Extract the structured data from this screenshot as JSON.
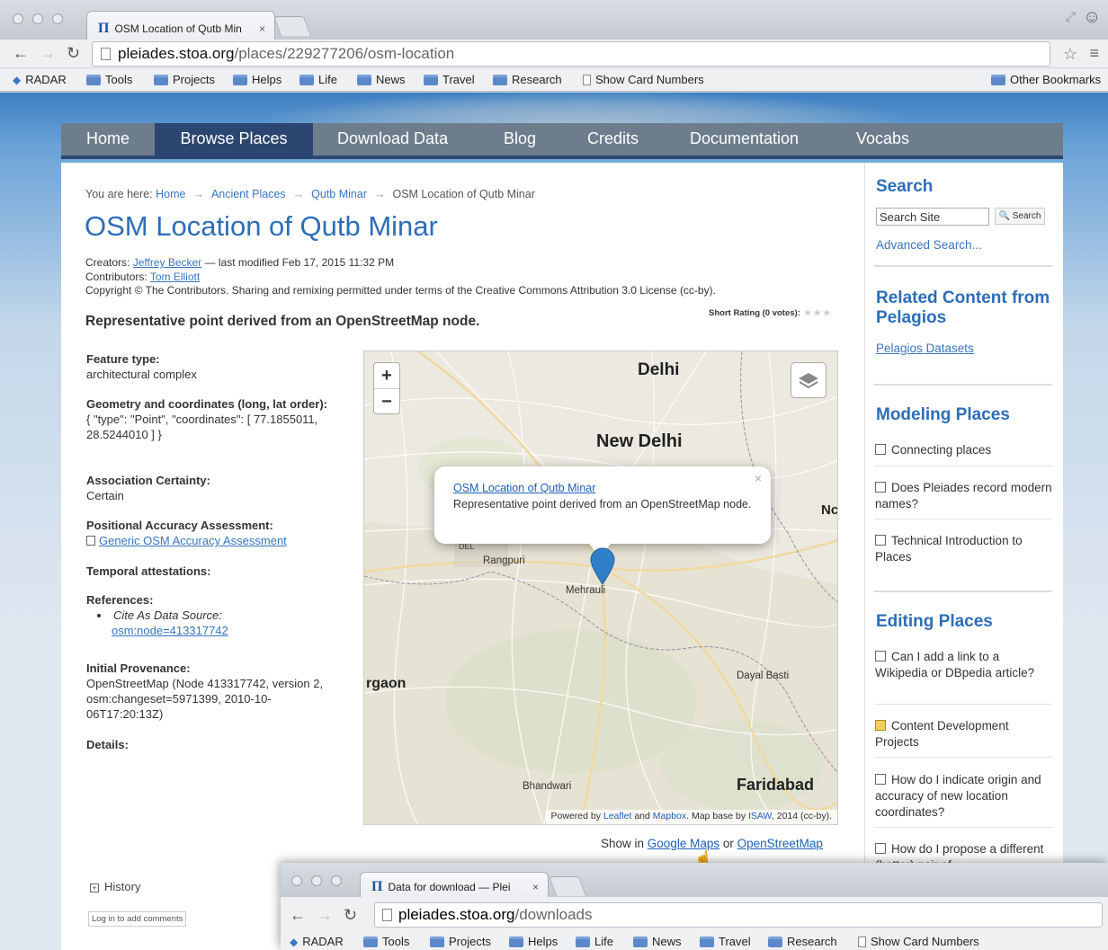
{
  "browser": {
    "tab_title": "OSM Location of Qutb Min",
    "tab_close": "×",
    "url_host": "pleiades.stoa.org",
    "url_path": "/places/229277206/osm-location",
    "bookmarks": [
      "RADAR",
      "Tools",
      "Projects",
      "Helps",
      "Life",
      "News",
      "Travel",
      "Research",
      "Show Card Numbers"
    ],
    "other_bookmarks": "Other Bookmarks"
  },
  "nav": [
    "Home",
    "Browse Places",
    "Download Data",
    "Blog",
    "Credits",
    "Documentation",
    "Vocabs"
  ],
  "breadcrumb": {
    "prefix": "You are here:",
    "items": [
      "Home",
      "Ancient Places",
      "Qutb Minar"
    ],
    "current": "OSM Location of Qutb Minar",
    "sep": "→"
  },
  "page_title": "OSM Location of Qutb Minar",
  "meta": {
    "creators_label": "Creators:",
    "creator": "Jeffrey Becker",
    "modified": "— last modified Feb 17, 2015 11:32 PM",
    "contributors_label": "Contributors:",
    "contributor": "Tom Elliott",
    "copyright": "Copyright © The Contributors. Sharing and remixing permitted under terms of the Creative Commons Attribution 3.0 License (cc-by)."
  },
  "description": "Representative point derived from an OpenStreetMap node.",
  "rating": {
    "label": "Short Rating (0 votes):",
    "stars": "★★★"
  },
  "fields": {
    "feature_type_label": "Feature type:",
    "feature_type": "architectural complex",
    "geometry_label": "Geometry and coordinates (long, lat order):",
    "geometry": "{ \"type\": \"Point\", \"coordinates\": [ 77.1855011, 28.5244010 ] }",
    "certainty_label": "Association Certainty:",
    "certainty": "Certain",
    "accuracy_label": "Positional Accuracy Assessment:",
    "accuracy_link": "Generic OSM Accuracy Assessment",
    "temporal_label": "Temporal attestations:",
    "references_label": "References:",
    "reference_cite": "Cite As Data Source:",
    "reference_link": "osm:node=413317742",
    "provenance_label": "Initial Provenance:",
    "provenance": "OpenStreetMap (Node 413317742, version 2, osm:changeset=5971399, 2010-10-06T17:20:13Z)",
    "details_label": "Details:"
  },
  "map": {
    "zoom_in": "+",
    "zoom_out": "−",
    "layers_icon": "layers-icon",
    "labels": [
      "Delhi",
      "New Delhi",
      "Nc",
      "DEL",
      "Rangpuri",
      "Mehrauli",
      "Dayal Basti",
      "rgaon",
      "Bhandwari",
      "Faridabad"
    ],
    "popup_link": "OSM Location of Qutb Minar",
    "popup_text": "Representative point derived from an OpenStreetMap node.",
    "popup_close": "×",
    "attribution": {
      "powered": "Powered by",
      "leaflet": "Leaflet",
      "and": "and",
      "mapbox": "Mapbox",
      "base": ". Map base by",
      "isaw": "ISAW",
      "year": ", 2014 (cc-by)."
    },
    "pin_color": "#2f80c8"
  },
  "show_in": {
    "prefix": "Show in",
    "google": "Google Maps",
    "or": "or",
    "osm": "OpenStreetMap"
  },
  "history": "History",
  "log_comment": "Log in to add comments",
  "sidebar": {
    "search_title": "Search",
    "search_placeholder": "Search Site",
    "search_button": "Search",
    "advanced": "Advanced Search...",
    "related_title": "Related Content from Pelagios",
    "pelagios_link": "Pelagios Datasets",
    "modeling_title": "Modeling Places",
    "modeling_items": [
      "Connecting places",
      "Does Pleiades record modern names?",
      "Technical Introduction to Places"
    ],
    "editing_title": "Editing Places",
    "editing_items": [
      "Can I add a link to a Wikipedia or DBpedia article?",
      "Content Development Projects",
      "How do I indicate origin and accuracy of new location coordinates?",
      "How do I propose a different (better) pair of"
    ]
  },
  "window2": {
    "tab_title": "Data for download — Plei",
    "tab_close": "×",
    "url_host": "pleiades.stoa.org",
    "url_path": "/downloads"
  },
  "colors": {
    "accent": "#2c6eb8",
    "nav_bg": "#6d7d8c",
    "nav_active": "#2b4771",
    "link": "#3775bf"
  }
}
